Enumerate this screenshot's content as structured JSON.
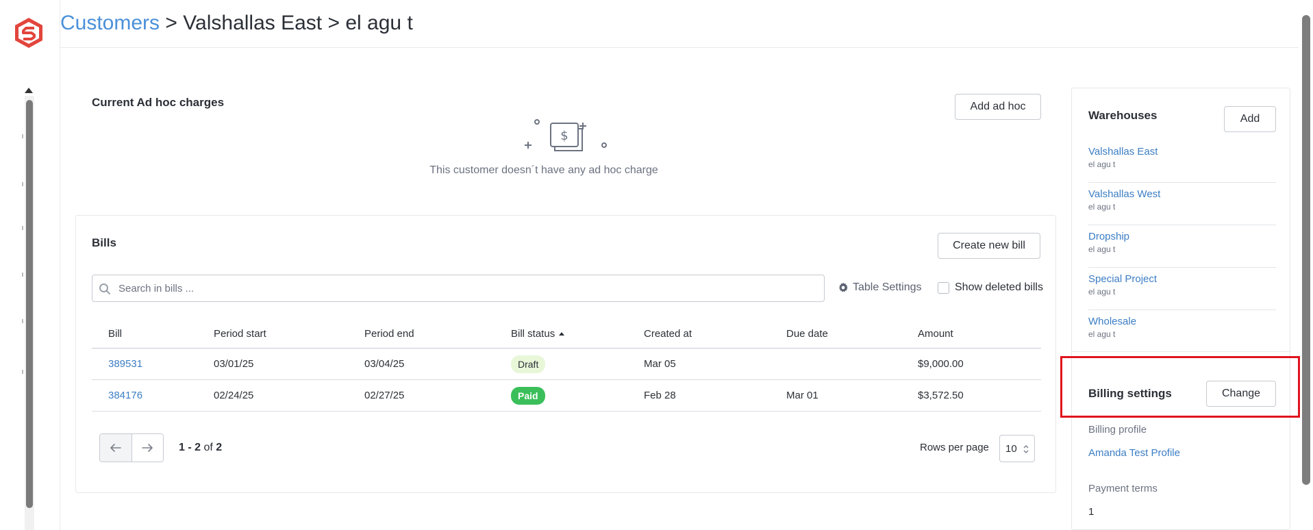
{
  "breadcrumb": {
    "root": "Customers",
    "separator": ">",
    "warehouse": "Valshallas East",
    "customer": "el agu t"
  },
  "adhoc": {
    "title": "Current Ad hoc charges",
    "add_button": "Add ad hoc",
    "empty_text": "This customer doesn´t have any ad hoc charge"
  },
  "bills": {
    "title": "Bills",
    "create_button": "Create new bill",
    "search_placeholder": "Search in bills ...",
    "table_settings": "Table Settings",
    "show_deleted": "Show deleted bills",
    "columns": {
      "bill": "Bill",
      "period_start": "Period start",
      "period_end": "Period end",
      "bill_status": "Bill status",
      "created_at": "Created at",
      "due_date": "Due date",
      "amount": "Amount"
    },
    "rows": [
      {
        "bill": "389531",
        "period_start": "03/01/25",
        "period_end": "03/04/25",
        "status": "Draft",
        "created_at": "Mar 05",
        "due_date": "",
        "amount": "$9,000.00"
      },
      {
        "bill": "384176",
        "period_start": "02/24/25",
        "period_end": "02/27/25",
        "status": "Paid",
        "created_at": "Feb 28",
        "due_date": "Mar 01",
        "amount": "$3,572.50"
      }
    ],
    "pagination": {
      "range": "1 - 2",
      "of": "of",
      "total": "2",
      "rows_per_page_label": "Rows per page",
      "rows_per_page": "10"
    }
  },
  "warehouses": {
    "title": "Warehouses",
    "add_button": "Add",
    "items": [
      {
        "name": "Valshallas East",
        "customer": "el agu t"
      },
      {
        "name": "Valshallas West",
        "customer": "el agu t"
      },
      {
        "name": "Dropship",
        "customer": "el agu t"
      },
      {
        "name": "Special Project",
        "customer": "el agu t"
      },
      {
        "name": "Wholesale",
        "customer": "el agu t"
      }
    ]
  },
  "billing_settings": {
    "title": "Billing settings",
    "change_button": "Change",
    "profile_label": "Billing profile",
    "profile_value": "Amanda Test Profile",
    "terms_label": "Payment terms",
    "terms_value": "1"
  },
  "colors": {
    "brand": "#e2453c",
    "link": "#3b7dc4",
    "paid_badge": "#3bbf5a",
    "draft_badge": "#e9f7d9",
    "highlight": "#e0141e"
  }
}
